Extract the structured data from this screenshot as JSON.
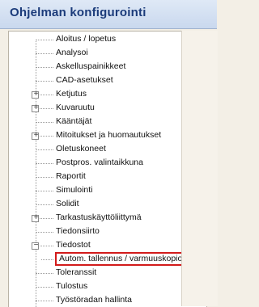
{
  "window": {
    "title": "Ohjelman konfigurointi"
  },
  "tree": {
    "items": [
      {
        "label": "Aloitus / lopetus",
        "expander": ""
      },
      {
        "label": "Analysoi",
        "expander": ""
      },
      {
        "label": "Askelluspainikkeet",
        "expander": ""
      },
      {
        "label": "CAD-asetukset",
        "expander": ""
      },
      {
        "label": "Ketjutus",
        "expander": "+"
      },
      {
        "label": "Kuvaruutu",
        "expander": "+"
      },
      {
        "label": "Kääntäjät",
        "expander": ""
      },
      {
        "label": "Mitoitukset ja huomautukset",
        "expander": "+"
      },
      {
        "label": "Oletuskoneet",
        "expander": ""
      },
      {
        "label": "Postpros. valintaikkuna",
        "expander": ""
      },
      {
        "label": "Raportit",
        "expander": ""
      },
      {
        "label": "Simulointi",
        "expander": ""
      },
      {
        "label": "Solidit",
        "expander": ""
      },
      {
        "label": "Tarkastuskäyttöliittymä",
        "expander": "+"
      },
      {
        "label": "Tiedonsiirto",
        "expander": ""
      },
      {
        "label": "Tiedostot",
        "expander": "−"
      },
      {
        "label": "Autom. tallennus / varmuuskopio",
        "expander": "",
        "child": true,
        "selected": true
      },
      {
        "label": "Toleranssit",
        "expander": ""
      },
      {
        "label": "Tulostus",
        "expander": ""
      },
      {
        "label": "Työstöradan hallinta",
        "expander": ""
      }
    ]
  }
}
